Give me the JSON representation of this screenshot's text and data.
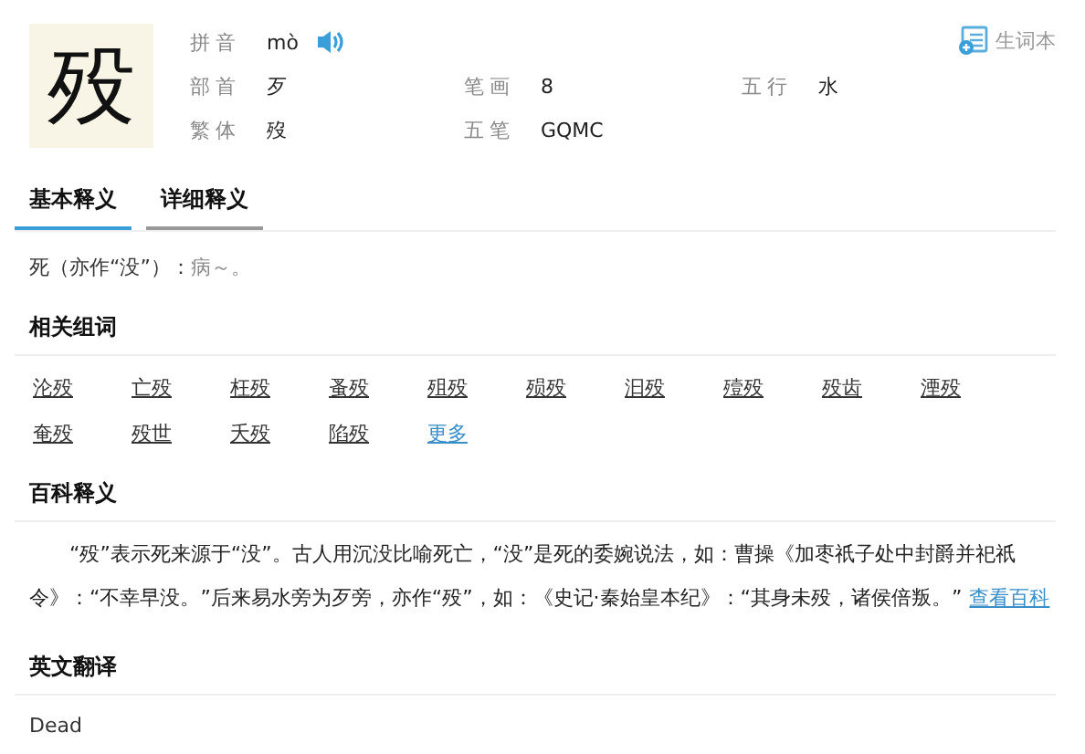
{
  "character": "殁",
  "info": [
    {
      "label": "拼音",
      "value": "mò",
      "audio": true
    },
    {
      "label": "部首",
      "value": "歹"
    },
    {
      "label": "笔画",
      "value": "8"
    },
    {
      "label": "五行",
      "value": "水"
    },
    {
      "label": "繁体",
      "value": "歿"
    },
    {
      "label": "五笔",
      "value": "GQMC"
    }
  ],
  "wordbook": "生词本",
  "tabs": [
    {
      "label": "基本释义",
      "selected": true
    },
    {
      "label": "详细释义",
      "selected": false
    }
  ],
  "definition": {
    "meaning": "死（亦作“没”）：",
    "example": "病～。"
  },
  "related": {
    "title": "相关组词",
    "words": [
      {
        "text": "沦殁",
        "kind": "word"
      },
      {
        "text": "亡殁",
        "kind": "word"
      },
      {
        "text": "枉殁",
        "kind": "word"
      },
      {
        "text": "蚤殁",
        "kind": "word"
      },
      {
        "text": "殂殁",
        "kind": "word"
      },
      {
        "text": "殒殁",
        "kind": "word"
      },
      {
        "text": "汩殁",
        "kind": "word"
      },
      {
        "text": "殪殁",
        "kind": "word"
      },
      {
        "text": "殁齿",
        "kind": "word"
      },
      {
        "text": "湮殁",
        "kind": "word"
      },
      {
        "text": "奄殁",
        "kind": "word"
      },
      {
        "text": "殁世",
        "kind": "word"
      },
      {
        "text": "夭殁",
        "kind": "word"
      },
      {
        "text": "陷殁",
        "kind": "word"
      },
      {
        "text": "更多",
        "kind": "more"
      }
    ]
  },
  "baike": {
    "title": "百科释义",
    "text": "“殁”表示死来源于“没”。古人用沉没比喻死亡，“没”是死的委婉说法，如：曹操《加枣祇子处中封爵并祀祇令》：“不幸早没。”后来易水旁为歹旁，亦作“殁”，如：《史记·秦始皇本纪》：“其身未殁，诸侯倍叛。”",
    "link": "查看百科"
  },
  "english": {
    "title": "英文翻译",
    "text": "Dead"
  }
}
